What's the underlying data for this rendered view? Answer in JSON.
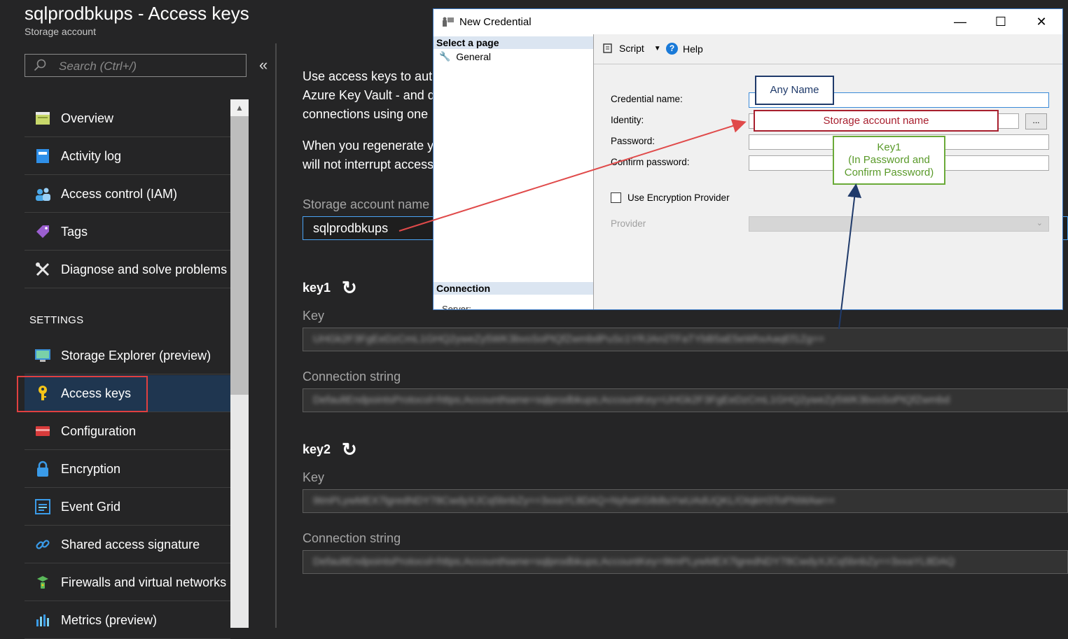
{
  "blade": {
    "title": "sqlprodbkups - Access keys",
    "subtitle": "Storage account"
  },
  "search": {
    "placeholder": "Search (Ctrl+/)"
  },
  "collapse_label": "«",
  "nav": {
    "items": [
      {
        "label": "Overview",
        "icon": "overview-icon"
      },
      {
        "label": "Activity log",
        "icon": "activity-log-icon"
      },
      {
        "label": "Access control (IAM)",
        "icon": "iam-icon"
      },
      {
        "label": "Tags",
        "icon": "tag-icon"
      },
      {
        "label": "Diagnose and solve problems",
        "icon": "wrench-icon"
      }
    ],
    "settings_header": "SETTINGS",
    "settings_items": [
      {
        "label": "Storage Explorer (preview)",
        "icon": "storage-explorer-icon"
      },
      {
        "label": "Access keys",
        "icon": "key-icon",
        "active": true
      },
      {
        "label": "Configuration",
        "icon": "configuration-icon"
      },
      {
        "label": "Encryption",
        "icon": "lock-icon"
      },
      {
        "label": "Event Grid",
        "icon": "event-grid-icon"
      },
      {
        "label": "Shared access signature",
        "icon": "link-icon"
      },
      {
        "label": "Firewalls and virtual networks",
        "icon": "firewall-icon"
      },
      {
        "label": "Metrics (preview)",
        "icon": "metrics-icon"
      }
    ]
  },
  "main": {
    "para1": [
      "Use access keys to auth",
      "Azure Key Vault - and d",
      "connections using one"
    ],
    "para2": [
      "When you regenerate y",
      "will not interrupt access"
    ],
    "storage_account_label": "Storage account name",
    "storage_account_value": "sqlprodbkups",
    "key1": {
      "heading": "key1",
      "key_label": "Key",
      "key_value": "UHGk2F3FgEeDzCmL1GHQ2yweZy5WK3bvoSoPtQfZwmbdPuSc1YRJAn2TFaTYbB5aE5eWhxAaqEf1Zg==",
      "conn_label": "Connection string",
      "conn_value": "DefaultEndpointsProtocol=https;AccountName=sqlprodbkups;AccountKey=UHGk2F3FgEeDzCmL1GHQ2yweZy5WK3bvoSoPtQfZwmbd"
    },
    "key2": {
      "heading": "key2",
      "key_label": "Key",
      "key_value": "9tmPLywMEX7lgredNDY78CwdyXJCq5bnbZy==3xxaYL8DAQ+NyhaKG8dtuYwUAdUQKL/OIqkH3ToPNWAw==",
      "conn_label": "Connection string",
      "conn_value": "DefaultEndpointsProtocol=https;AccountName=sqlprodbkups;AccountKey=9tmPLywMEX7lgredNDY78CwdyXJCq5bnbZy==3xxaYL8DAQ"
    }
  },
  "dialog": {
    "title": "New Credential",
    "select_page": "Select a page",
    "general": "General",
    "connection": "Connection",
    "server": "Server:",
    "toolbar": {
      "script": "Script",
      "help": "Help"
    },
    "form": {
      "credential_name": "Credential name:",
      "identity": "Identity:",
      "password": "Password:",
      "confirm_password": "Confirm password:",
      "use_encryption": "Use Encryption Provider",
      "provider": "Provider",
      "browse": "..."
    },
    "window_buttons": {
      "minimize": "—",
      "maximize": "☐",
      "close": "✕"
    }
  },
  "annotations": {
    "any_name": "Any Name",
    "storage_account_name": "Storage account name",
    "key1_line1": "Key1",
    "key1_line2": "(In Password and",
    "key1_line3": "Confirm Password)"
  },
  "colors": {
    "accent": "#0078d4",
    "active_bg": "#1f3650",
    "highlight_red": "#e04040",
    "note_blue": "#1f3a6a",
    "note_red": "#a81f2e",
    "note_green": "#6aaa38"
  }
}
